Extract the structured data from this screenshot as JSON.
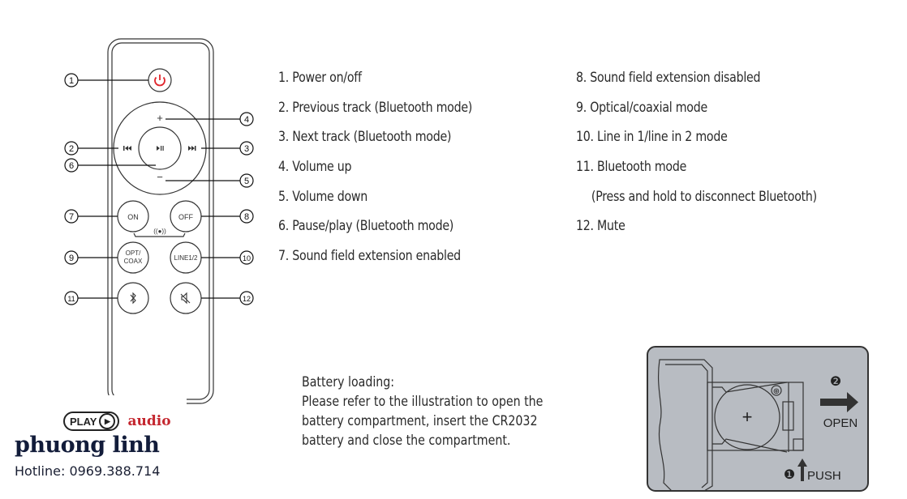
{
  "remote": {
    "callouts": [
      "1",
      "2",
      "3",
      "4",
      "5",
      "6",
      "7",
      "8",
      "9",
      "10",
      "11",
      "12"
    ],
    "buttons": {
      "power": "power-icon",
      "prev": "⏮",
      "playpause": "⏯",
      "next": "⏭",
      "vol_up": "+",
      "vol_down": "−",
      "on": "ON",
      "off": "OFF",
      "opt_line1": "OPT/",
      "opt_line2": "COAX",
      "line": "LINE1/2",
      "bluetooth": "bluetooth-icon",
      "mute": "mute-icon",
      "sound_field_icon": "((●))"
    },
    "colors": {
      "power": "#e0262d",
      "outline": "#333333"
    }
  },
  "legend": {
    "left": [
      "1. Power on/off",
      "2. Previous track (Bluetooth mode)",
      "3. Next track (Bluetooth mode)",
      "4. Volume up",
      "5. Volume down",
      "6. Pause/play (Bluetooth mode)",
      "7. Sound field extension enabled"
    ],
    "right": [
      "8. Sound field extension disabled",
      "9. Optical/coaxial mode",
      "10. Line in 1/line in 2 mode",
      "11. Bluetooth mode",
      "(Press and hold to disconnect Bluetooth)",
      "12. Mute"
    ]
  },
  "battery": {
    "heading": "Battery loading:",
    "lines": [
      "Please refer to the illustration to open the",
      "battery compartment, insert the CR2032",
      "battery and close the compartment."
    ],
    "illustration": {
      "step2_label": "❷",
      "open_label": "OPEN",
      "step1_label": "❶",
      "push_label": "PUSH",
      "plus_symbol": "+",
      "polarity_symbol": "⊕",
      "background": "#b8bcc2"
    }
  },
  "watermark": {
    "play_label": "PLAY",
    "audio_label": "audio",
    "brand": "phuong linh",
    "hotline": "Hotline: 0969.388.714",
    "colors": {
      "brand": "#121c3a",
      "audio": "#c4262e"
    }
  }
}
